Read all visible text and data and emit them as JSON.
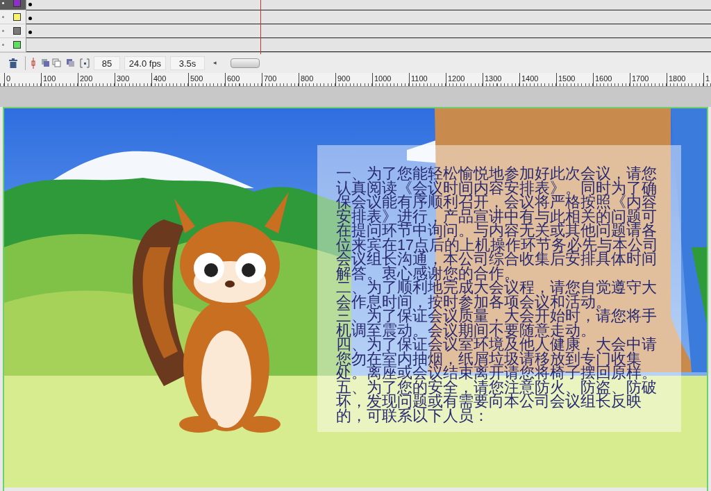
{
  "layers": [
    {
      "color": "#8e2fc6",
      "selected": true,
      "keyframe": true
    },
    {
      "color": "#f6f46a",
      "selected": false,
      "keyframe": true
    },
    {
      "color": "#7a7a7a",
      "selected": false,
      "keyframe": true
    },
    {
      "color": "#5ee05e",
      "selected": false,
      "keyframe": false
    }
  ],
  "timeline_status": {
    "current_frame": "85",
    "frame_rate": "24.0 fps",
    "elapsed_time": "3.5s",
    "scroll_left": "◂"
  },
  "ruler": {
    "ticks": [
      "0",
      "100",
      "200",
      "300",
      "400",
      "500",
      "600",
      "700",
      "800",
      "900",
      "1000",
      "1100",
      "1200",
      "1300",
      "1400",
      "1500",
      "1600",
      "1700",
      "1800",
      "1"
    ]
  },
  "stage": {
    "notice_paragraphs": [
      "一、为了您能轻松愉悦地参加好此次会议，请您认真阅读《会议时间内容安排表》。同时为了确保会议能有序顺利召开，会议将严格按照《内容安排表》进行，产品宣讲中有与此相关的问题可在提问环节中询问。与内容无关或其他问题请各位来宾在17点后的上机操作环节务必先与本公司会议组长沟通，本公司综合收集后安排具体时间解答。衷心感谢您的合作。",
      "二、为了顺利地完成大会议程，请您自觉遵守大会作息时间，按时参加各项会议和活动。",
      "三、为了保证会议质量，大会开始时，请您将手机调至震动。会议期间不要随意走动。",
      "四、为了保证会议室环境及他人健康，大会中请您勿在室内抽烟，纸屑垃圾请移放到专门收集处。离座或会议结束离开请您将椅子摆回原样。",
      "五、为了您的安全，请您注意防火、防盗、防破坏，发现问题或有需要向本公司会议组长反映的，可联系以下人员："
    ]
  }
}
